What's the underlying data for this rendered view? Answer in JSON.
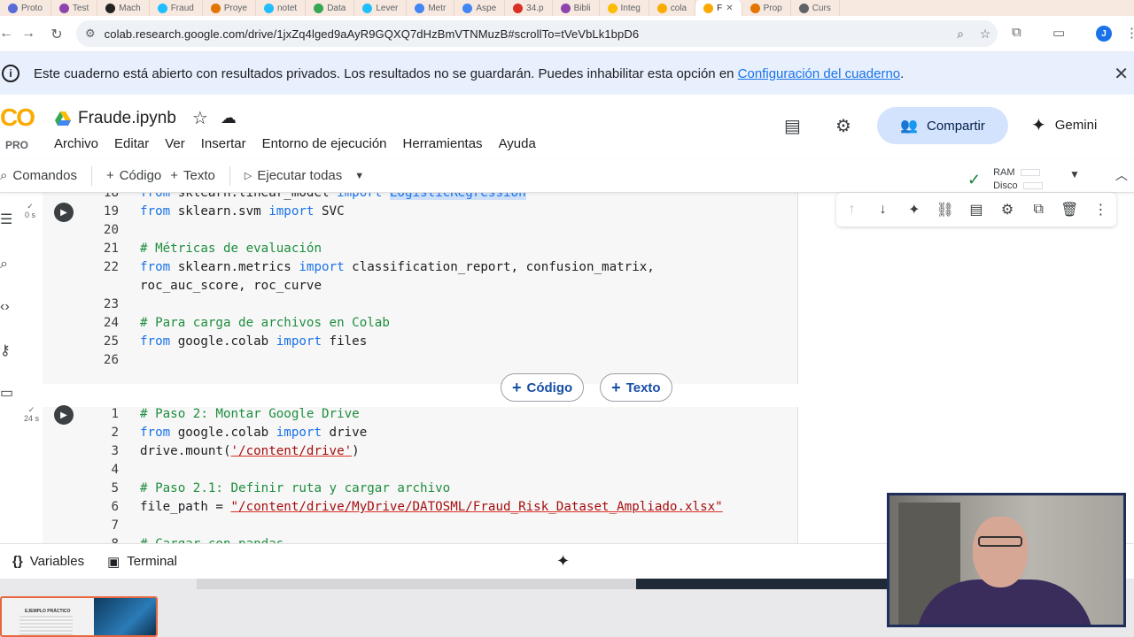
{
  "browser": {
    "tabs": [
      {
        "label": "Proto",
        "color": "#5b6bd6"
      },
      {
        "label": "Test",
        "color": "#8e44ad"
      },
      {
        "label": "Mach",
        "color": "#222222"
      },
      {
        "label": "Fraud",
        "color": "#20beff"
      },
      {
        "label": "Proye",
        "color": "#e37400"
      },
      {
        "label": "notet",
        "color": "#20beff"
      },
      {
        "label": "Data",
        "color": "#34a853"
      },
      {
        "label": "Lever",
        "color": "#20beff"
      },
      {
        "label": "Metr",
        "color": "#4285f4"
      },
      {
        "label": "Aspe",
        "color": "#4285f4"
      },
      {
        "label": "34.p",
        "color": "#d93025"
      },
      {
        "label": "Bibli",
        "color": "#8e44ad"
      },
      {
        "label": "Integ",
        "color": "#fbbc04"
      },
      {
        "label": "cola",
        "color": "#f9ab00"
      },
      {
        "label": "F",
        "color": "#f9ab00",
        "active": true
      },
      {
        "label": "Prop",
        "color": "#e37400"
      },
      {
        "label": "Curs",
        "color": "#5f6368"
      }
    ],
    "url": "colab.research.google.com/drive/1jxZq4lged9aAyR9GQXQ7dHzBmVTNMuzB#scrollTo=tVeVbLk1bpD6",
    "profile_initial": "J"
  },
  "banner": {
    "text": "Este cuaderno está abierto con resultados privados. Los resultados no se guardarán. Puedes inhabilitar esta opción en ",
    "link": "Configuración del cuaderno",
    "suffix": "."
  },
  "header": {
    "logo_text": "CO",
    "pro_label": "PRO",
    "title": "Fraude.ipynb",
    "menus": [
      "Archivo",
      "Editar",
      "Ver",
      "Insertar",
      "Entorno de ejecución",
      "Herramientas",
      "Ayuda"
    ],
    "share_label": "Compartir",
    "gemini_label": "Gemini"
  },
  "toolbar": {
    "commands": "Comandos",
    "add_code": "Código",
    "add_text": "Texto",
    "run_all": "Ejecutar todas",
    "ram": "RAM",
    "disk": "Disco"
  },
  "cell1": {
    "exec_time": "0 s",
    "lines": [
      {
        "n": "18",
        "parts": [
          [
            "kw",
            "from"
          ],
          [
            "src",
            " sklearn.linear_model "
          ],
          [
            "kw",
            "import"
          ],
          [
            "src",
            " "
          ],
          [
            "hl",
            "LogisticRegression"
          ]
        ]
      },
      {
        "n": "19",
        "parts": [
          [
            "kw",
            "from"
          ],
          [
            "src",
            " sklearn.svm "
          ],
          [
            "kw",
            "import"
          ],
          [
            "src",
            " SVC"
          ]
        ]
      },
      {
        "n": "20",
        "parts": []
      },
      {
        "n": "21",
        "parts": [
          [
            "cm",
            "# Métricas de evaluación"
          ]
        ]
      },
      {
        "n": "22",
        "parts": [
          [
            "kw",
            "from"
          ],
          [
            "src",
            " sklearn.metrics "
          ],
          [
            "kw",
            "import"
          ],
          [
            "src",
            " classification_report, confusion_matrix,"
          ]
        ]
      },
      {
        "n": "",
        "parts": [
          [
            "src",
            "roc_auc_score, roc_curve"
          ]
        ]
      },
      {
        "n": "23",
        "parts": []
      },
      {
        "n": "24",
        "parts": [
          [
            "cm",
            "# Para carga de archivos en Colab"
          ]
        ]
      },
      {
        "n": "25",
        "parts": [
          [
            "kw",
            "from"
          ],
          [
            "src",
            " google.colab "
          ],
          [
            "kw",
            "import"
          ],
          [
            "src",
            " files"
          ]
        ]
      },
      {
        "n": "26",
        "parts": []
      }
    ]
  },
  "add_buttons": {
    "code": "Código",
    "text": "Texto"
  },
  "cell2": {
    "exec_time": "24 s",
    "lines": [
      {
        "n": "1",
        "parts": [
          [
            "cm",
            "# Paso 2: Montar Google Drive"
          ]
        ]
      },
      {
        "n": "2",
        "parts": [
          [
            "kw",
            "from"
          ],
          [
            "src",
            " google.colab "
          ],
          [
            "kw",
            "import"
          ],
          [
            "src",
            " drive"
          ]
        ]
      },
      {
        "n": "3",
        "parts": [
          [
            "src",
            "drive.mount("
          ],
          [
            "st",
            "'/content/drive'"
          ],
          [
            "src",
            ")"
          ]
        ]
      },
      {
        "n": "4",
        "parts": []
      },
      {
        "n": "5",
        "parts": [
          [
            "cm",
            "# Paso 2.1: Definir ruta y cargar archivo"
          ]
        ]
      },
      {
        "n": "6",
        "parts": [
          [
            "src",
            "file_path = "
          ],
          [
            "st",
            "\"/content/drive/MyDrive/DATOSML/Fraud_Risk_Dataset_Ampliado.xlsx\""
          ]
        ]
      },
      {
        "n": "7",
        "parts": []
      },
      {
        "n": "8",
        "parts": [
          [
            "cm",
            "# Cargar con pandas"
          ]
        ]
      }
    ]
  },
  "bottom": {
    "variables": "Variables",
    "terminal": "Terminal"
  },
  "slide_thumb_title": "EJEMPLO PRÁCTICO"
}
